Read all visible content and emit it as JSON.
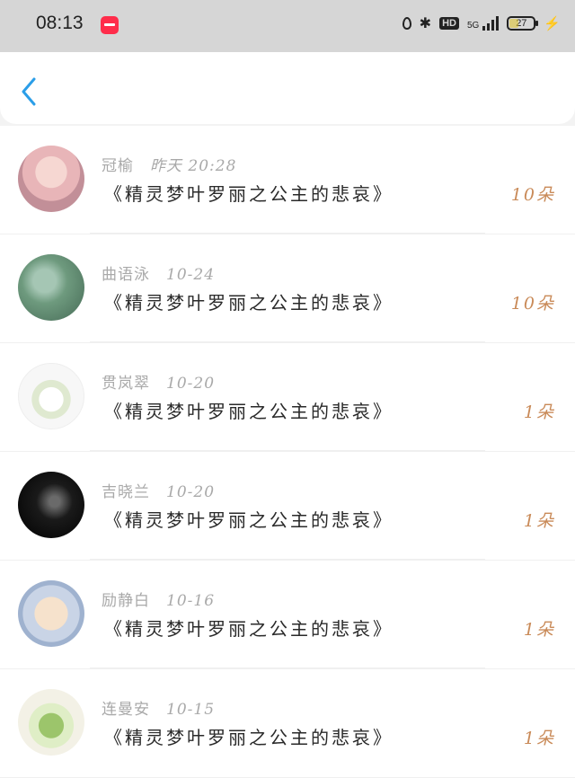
{
  "status_bar": {
    "time": "08:13",
    "network": "5G",
    "hd": "HD",
    "battery": "27"
  },
  "list": [
    {
      "name": "冠榆",
      "time": "昨天 20:28",
      "title": "《精灵梦叶罗丽之公主的悲哀》",
      "count": "10朵"
    },
    {
      "name": "曲语泳",
      "time": "10-24",
      "title": "《精灵梦叶罗丽之公主的悲哀》",
      "count": "10朵"
    },
    {
      "name": "贯岚翠",
      "time": "10-20",
      "title": "《精灵梦叶罗丽之公主的悲哀》",
      "count": "1朵"
    },
    {
      "name": "吉晓兰",
      "time": "10-20",
      "title": "《精灵梦叶罗丽之公主的悲哀》",
      "count": "1朵"
    },
    {
      "name": "励静白",
      "time": "10-16",
      "title": "《精灵梦叶罗丽之公主的悲哀》",
      "count": "1朵"
    },
    {
      "name": "连曼安",
      "time": "10-15",
      "title": "《精灵梦叶罗丽之公主的悲哀》",
      "count": "1朵"
    }
  ],
  "colors": {
    "accent_back": "#2b9ee8",
    "count": "#c98a58"
  }
}
